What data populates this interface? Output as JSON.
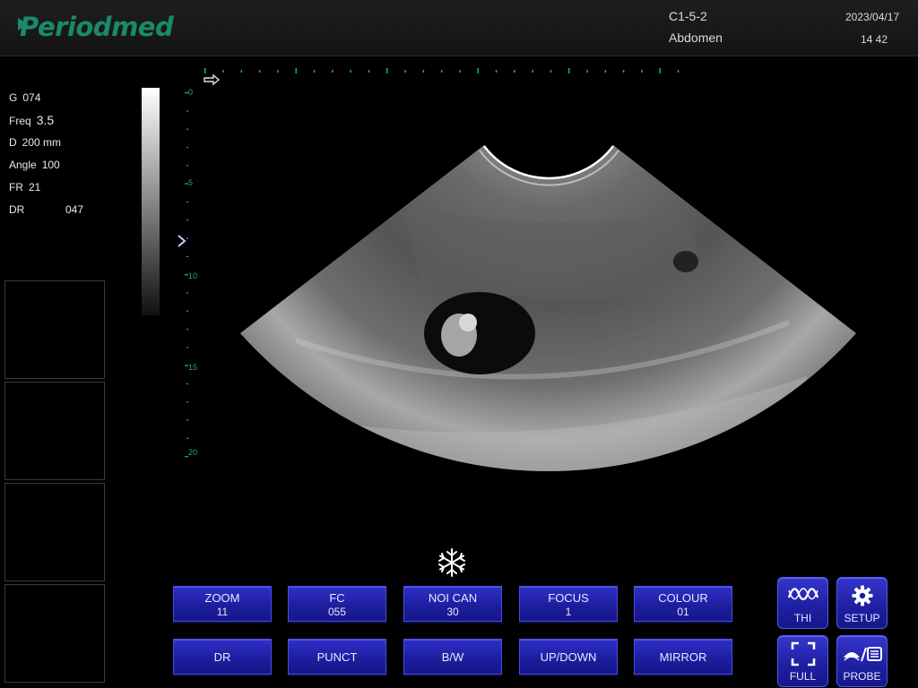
{
  "header": {
    "brand": "Periodmed",
    "probe": "C1-5-2",
    "preset": "Abdomen",
    "date": "2023/04/17",
    "time": "14 42"
  },
  "params": [
    {
      "label": "G",
      "value": "074"
    },
    {
      "label": "Freq",
      "value": "3.5"
    },
    {
      "label": "D",
      "value": "200 mm"
    },
    {
      "label": "Angle",
      "value": "100"
    },
    {
      "label": "FR",
      "value": "21"
    },
    {
      "label": "DR",
      "value": "047"
    }
  ],
  "depth_scale": {
    "labels": [
      "0",
      "5",
      "10",
      "15",
      "20"
    ]
  },
  "controls": {
    "row1": [
      {
        "label": "ZOOM",
        "value": "11"
      },
      {
        "label": "FC",
        "value": "055"
      },
      {
        "label": "NOI CAN",
        "value": "30"
      },
      {
        "label": "FOCUS",
        "value": "1"
      },
      {
        "label": "COLOUR",
        "value": "01"
      }
    ],
    "row2": [
      {
        "label": "DR"
      },
      {
        "label": "PUNCT"
      },
      {
        "label": "B/W"
      },
      {
        "label": "UP/DOWN"
      },
      {
        "label": "MIRROR"
      }
    ]
  },
  "side_buttons": {
    "thi": "THI",
    "setup": "SETUP",
    "full": "FULL",
    "probe": "PROBE"
  },
  "icons": {
    "freeze": "snowflake-icon",
    "thi": "wave-icon",
    "setup": "gear-icon",
    "full": "fullscreen-icon",
    "probe": "probe-icon"
  },
  "colors": {
    "brand": "#1a8a6a",
    "button": "#2224b0",
    "scale_teal": "#1aa6a0"
  }
}
